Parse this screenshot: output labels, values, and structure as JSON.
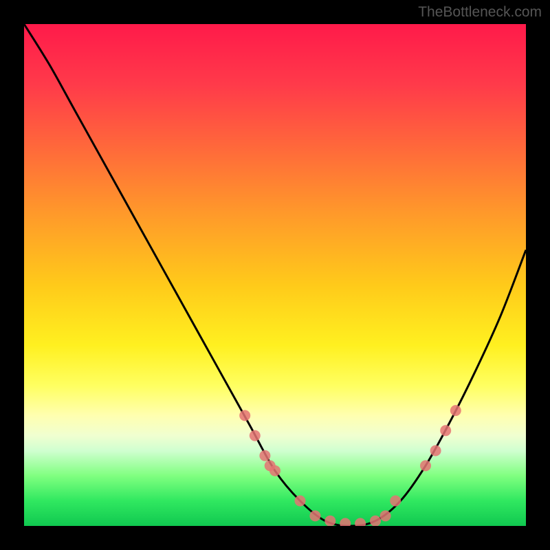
{
  "watermark": "TheBottleneck.com",
  "chart_data": {
    "type": "line",
    "title": "",
    "xlabel": "",
    "ylabel": "",
    "xlim": [
      0,
      100
    ],
    "ylim": [
      0,
      100
    ],
    "curve": {
      "x": [
        0,
        5,
        10,
        15,
        20,
        25,
        30,
        35,
        40,
        45,
        50,
        55,
        60,
        65,
        70,
        75,
        80,
        85,
        90,
        95,
        100
      ],
      "y": [
        100,
        92,
        83,
        74,
        65,
        56,
        47,
        38,
        29,
        20,
        11,
        5,
        1,
        0,
        1,
        5,
        12,
        21,
        31,
        42,
        55
      ]
    },
    "marker_points": {
      "x": [
        44,
        46,
        48,
        49,
        50,
        55,
        58,
        61,
        64,
        67,
        70,
        72,
        74,
        80,
        82,
        84,
        86
      ],
      "y": [
        22,
        18,
        14,
        12,
        11,
        5,
        2,
        1,
        0.5,
        0.5,
        1,
        2,
        5,
        12,
        15,
        19,
        23
      ]
    },
    "gradient_colors": {
      "top": "#ff1a4a",
      "mid": "#fff020",
      "bottom": "#10c850"
    }
  }
}
